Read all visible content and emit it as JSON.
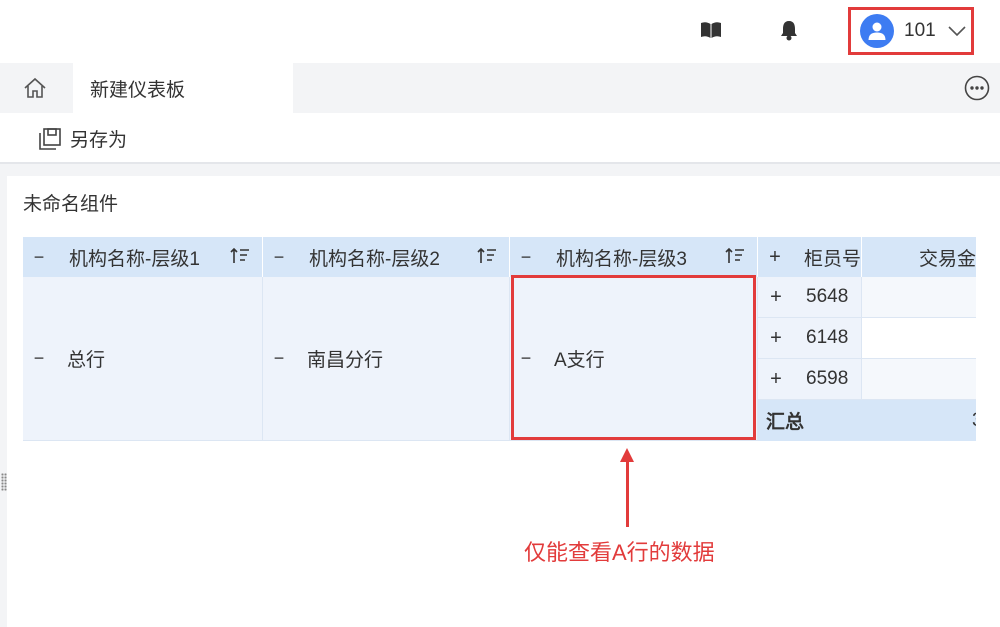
{
  "user": {
    "name": "101"
  },
  "tabs": {
    "active": "新建仪表板"
  },
  "toolbar": {
    "saveas": "另存为"
  },
  "component": {
    "title": "未命名组件"
  },
  "table": {
    "headers": [
      "机构名称-层级1",
      "机构名称-层级2",
      "机构名称-层级3",
      "柜员号",
      "交易金"
    ],
    "level1": "总行",
    "level2": "南昌分行",
    "level3": "A支行",
    "tellers": [
      "5648",
      "6148",
      "6598"
    ],
    "subtotal_label": "汇总",
    "subtotal_value": "3"
  },
  "annotation": {
    "text": "仅能查看A行的数据"
  },
  "colors": {
    "highlight": "#e23b3b",
    "avatar": "#3d7cf2",
    "header_bg": "#d6e6f8",
    "body_bg": "#eef3fb"
  }
}
